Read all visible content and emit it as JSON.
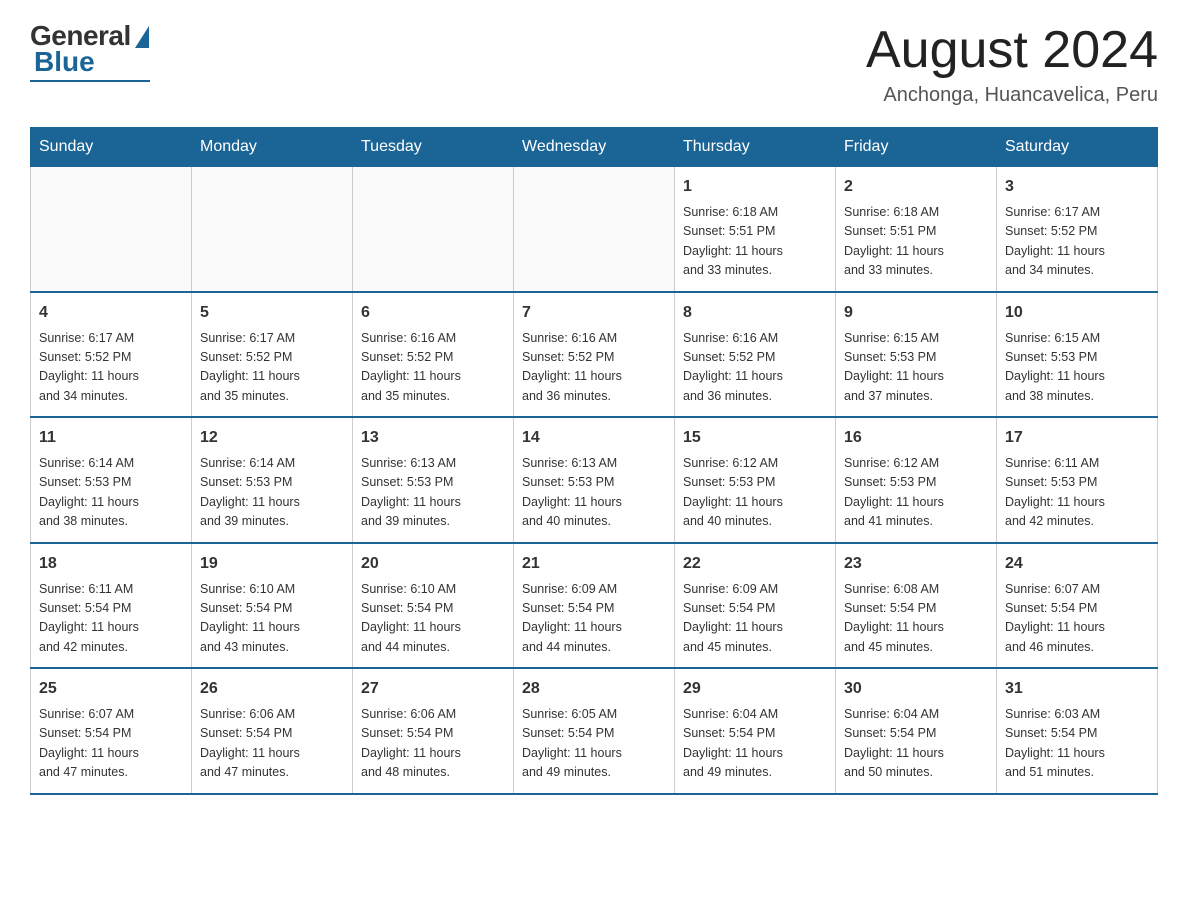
{
  "header": {
    "logo_general": "General",
    "logo_blue": "Blue",
    "month_title": "August 2024",
    "location": "Anchonga, Huancavelica, Peru"
  },
  "days_of_week": [
    "Sunday",
    "Monday",
    "Tuesday",
    "Wednesday",
    "Thursday",
    "Friday",
    "Saturday"
  ],
  "weeks": [
    [
      {
        "day": "",
        "info": ""
      },
      {
        "day": "",
        "info": ""
      },
      {
        "day": "",
        "info": ""
      },
      {
        "day": "",
        "info": ""
      },
      {
        "day": "1",
        "info": "Sunrise: 6:18 AM\nSunset: 5:51 PM\nDaylight: 11 hours\nand 33 minutes."
      },
      {
        "day": "2",
        "info": "Sunrise: 6:18 AM\nSunset: 5:51 PM\nDaylight: 11 hours\nand 33 minutes."
      },
      {
        "day": "3",
        "info": "Sunrise: 6:17 AM\nSunset: 5:52 PM\nDaylight: 11 hours\nand 34 minutes."
      }
    ],
    [
      {
        "day": "4",
        "info": "Sunrise: 6:17 AM\nSunset: 5:52 PM\nDaylight: 11 hours\nand 34 minutes."
      },
      {
        "day": "5",
        "info": "Sunrise: 6:17 AM\nSunset: 5:52 PM\nDaylight: 11 hours\nand 35 minutes."
      },
      {
        "day": "6",
        "info": "Sunrise: 6:16 AM\nSunset: 5:52 PM\nDaylight: 11 hours\nand 35 minutes."
      },
      {
        "day": "7",
        "info": "Sunrise: 6:16 AM\nSunset: 5:52 PM\nDaylight: 11 hours\nand 36 minutes."
      },
      {
        "day": "8",
        "info": "Sunrise: 6:16 AM\nSunset: 5:52 PM\nDaylight: 11 hours\nand 36 minutes."
      },
      {
        "day": "9",
        "info": "Sunrise: 6:15 AM\nSunset: 5:53 PM\nDaylight: 11 hours\nand 37 minutes."
      },
      {
        "day": "10",
        "info": "Sunrise: 6:15 AM\nSunset: 5:53 PM\nDaylight: 11 hours\nand 38 minutes."
      }
    ],
    [
      {
        "day": "11",
        "info": "Sunrise: 6:14 AM\nSunset: 5:53 PM\nDaylight: 11 hours\nand 38 minutes."
      },
      {
        "day": "12",
        "info": "Sunrise: 6:14 AM\nSunset: 5:53 PM\nDaylight: 11 hours\nand 39 minutes."
      },
      {
        "day": "13",
        "info": "Sunrise: 6:13 AM\nSunset: 5:53 PM\nDaylight: 11 hours\nand 39 minutes."
      },
      {
        "day": "14",
        "info": "Sunrise: 6:13 AM\nSunset: 5:53 PM\nDaylight: 11 hours\nand 40 minutes."
      },
      {
        "day": "15",
        "info": "Sunrise: 6:12 AM\nSunset: 5:53 PM\nDaylight: 11 hours\nand 40 minutes."
      },
      {
        "day": "16",
        "info": "Sunrise: 6:12 AM\nSunset: 5:53 PM\nDaylight: 11 hours\nand 41 minutes."
      },
      {
        "day": "17",
        "info": "Sunrise: 6:11 AM\nSunset: 5:53 PM\nDaylight: 11 hours\nand 42 minutes."
      }
    ],
    [
      {
        "day": "18",
        "info": "Sunrise: 6:11 AM\nSunset: 5:54 PM\nDaylight: 11 hours\nand 42 minutes."
      },
      {
        "day": "19",
        "info": "Sunrise: 6:10 AM\nSunset: 5:54 PM\nDaylight: 11 hours\nand 43 minutes."
      },
      {
        "day": "20",
        "info": "Sunrise: 6:10 AM\nSunset: 5:54 PM\nDaylight: 11 hours\nand 44 minutes."
      },
      {
        "day": "21",
        "info": "Sunrise: 6:09 AM\nSunset: 5:54 PM\nDaylight: 11 hours\nand 44 minutes."
      },
      {
        "day": "22",
        "info": "Sunrise: 6:09 AM\nSunset: 5:54 PM\nDaylight: 11 hours\nand 45 minutes."
      },
      {
        "day": "23",
        "info": "Sunrise: 6:08 AM\nSunset: 5:54 PM\nDaylight: 11 hours\nand 45 minutes."
      },
      {
        "day": "24",
        "info": "Sunrise: 6:07 AM\nSunset: 5:54 PM\nDaylight: 11 hours\nand 46 minutes."
      }
    ],
    [
      {
        "day": "25",
        "info": "Sunrise: 6:07 AM\nSunset: 5:54 PM\nDaylight: 11 hours\nand 47 minutes."
      },
      {
        "day": "26",
        "info": "Sunrise: 6:06 AM\nSunset: 5:54 PM\nDaylight: 11 hours\nand 47 minutes."
      },
      {
        "day": "27",
        "info": "Sunrise: 6:06 AM\nSunset: 5:54 PM\nDaylight: 11 hours\nand 48 minutes."
      },
      {
        "day": "28",
        "info": "Sunrise: 6:05 AM\nSunset: 5:54 PM\nDaylight: 11 hours\nand 49 minutes."
      },
      {
        "day": "29",
        "info": "Sunrise: 6:04 AM\nSunset: 5:54 PM\nDaylight: 11 hours\nand 49 minutes."
      },
      {
        "day": "30",
        "info": "Sunrise: 6:04 AM\nSunset: 5:54 PM\nDaylight: 11 hours\nand 50 minutes."
      },
      {
        "day": "31",
        "info": "Sunrise: 6:03 AM\nSunset: 5:54 PM\nDaylight: 11 hours\nand 51 minutes."
      }
    ]
  ]
}
